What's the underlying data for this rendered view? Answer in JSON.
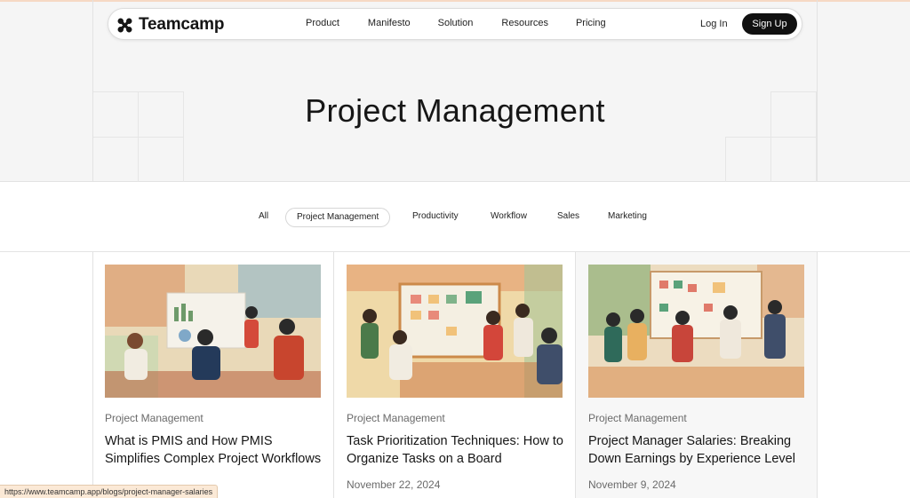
{
  "nav": {
    "logo_text": "Teamcamp",
    "links": [
      "Product",
      "Manifesto",
      "Solution",
      "Resources",
      "Pricing"
    ],
    "login": "Log In",
    "signup": "Sign Up"
  },
  "hero": {
    "title": "Project Management"
  },
  "filters": {
    "items": [
      "All",
      "Project Management",
      "Productivity",
      "Workflow",
      "Sales",
      "Marketing"
    ],
    "active": "Project Management"
  },
  "cards": [
    {
      "category": "Project Management",
      "title": "What is PMIS and How PMIS Simplifies Complex Project Workflows",
      "date": ""
    },
    {
      "category": "Project Management",
      "title": "Task Prioritization Techniques: How to Organize Tasks on a Board",
      "date": "November 22, 2024"
    },
    {
      "category": "Project Management",
      "title": "Project Manager Salaries: Breaking Down Earnings by Experience Level",
      "date": "November 9, 2024"
    }
  ],
  "status_url": "https://www.teamcamp.app/blogs/project-manager-salaries",
  "colors": {
    "button_dark": "#111111",
    "accent_status": "#fbe9d6"
  }
}
